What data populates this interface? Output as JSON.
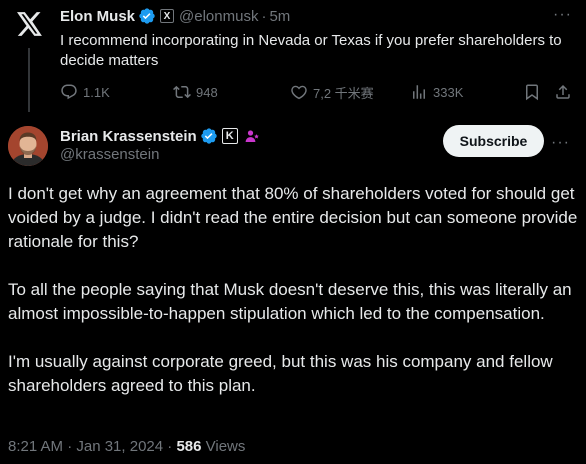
{
  "parent_tweet": {
    "name": "Elon Musk",
    "handle": "@elonmusk",
    "separator": "·",
    "time": "5m",
    "badge_label": "X",
    "text": "I recommend incorporating in Nevada or Texas if you prefer shareholders to decide matters",
    "actions": {
      "replies": "1.1K",
      "reposts": "948",
      "likes": "7,2 千米赛",
      "views": "333K"
    },
    "more_label": "···"
  },
  "main_tweet": {
    "name": "Brian Krassenstein",
    "handle": "@krassenstein",
    "affiliate_label": "K",
    "subscribe_label": "Subscribe",
    "more_label": "···",
    "paragraphs": [
      "I don't get why an agreement that 80% of shareholders voted for should get voided by a judge. I didn't read the entire decision but can someone provide rationale for this?",
      "To all the people saying that Musk doesn't deserve this, this was literally an almost impossible-to-happen stipulation which led to the compensation.",
      "I'm usually against corporate greed, but this was his company and fellow shareholders agreed to this plan."
    ],
    "timestamp": "8:21 AM · Jan 31, 2024 · ",
    "views_count": "586",
    "views_label": " Views"
  },
  "colors": {
    "background": "#000000",
    "text": "#e7e9ea",
    "muted": "#71767b",
    "verified_blue": "#1d9bf0",
    "subscriber_pink": "#c936cc"
  }
}
